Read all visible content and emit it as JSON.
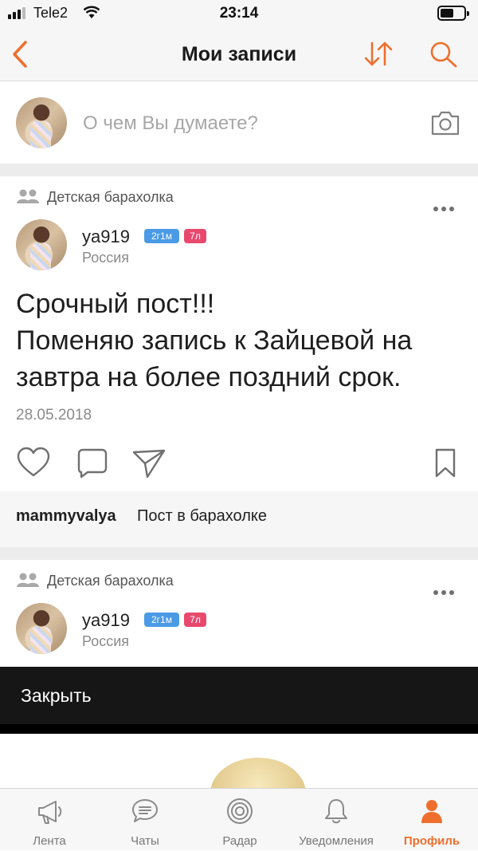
{
  "status_bar": {
    "carrier": "Tele2",
    "time": "23:14"
  },
  "nav": {
    "title": "Мои записи"
  },
  "composer": {
    "placeholder": "О чем Вы думаете?"
  },
  "posts": [
    {
      "group": "Детская барахолка",
      "username": "ya919",
      "badge_age": "2г1м",
      "badge_child": "7л",
      "country": "Россия",
      "text_lines": [
        "Срочный пост!!!",
        "Поменяю запись к Зайцевой на",
        "завтра на более поздний срок."
      ],
      "date": "28.05.2018",
      "comment": {
        "author": "mammyvalya",
        "text": "Пост в барахолке"
      }
    },
    {
      "group": "Детская барахолка",
      "username": "ya919",
      "badge_age": "2г1м",
      "badge_child": "7л",
      "country": "Россия"
    }
  ],
  "overlay": {
    "close_label": "Закрыть"
  },
  "tabbar": {
    "items": [
      {
        "label": "Лента",
        "icon": "megaphone-icon"
      },
      {
        "label": "Чаты",
        "icon": "chat-icon"
      },
      {
        "label": "Радар",
        "icon": "radar-icon"
      },
      {
        "label": "Уведомления",
        "icon": "bell-icon"
      },
      {
        "label": "Профиль",
        "icon": "person-icon",
        "active": true
      }
    ]
  },
  "colors": {
    "accent": "#ee6f2d",
    "badge_blue": "#4a9ae6",
    "badge_pink": "#e8496d",
    "overlay": "#161616"
  }
}
